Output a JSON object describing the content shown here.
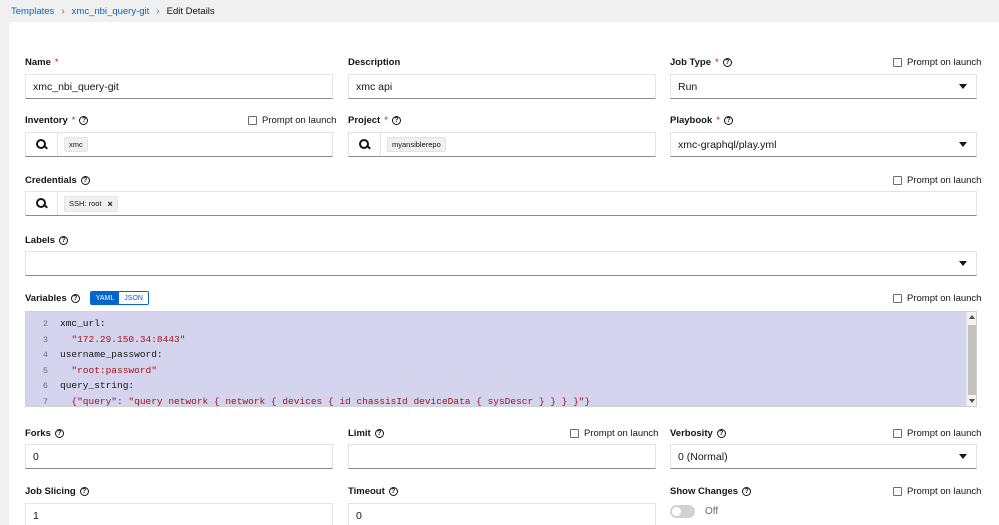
{
  "breadcrumb": {
    "templates": "Templates",
    "template_name": "xmc_nbi_query-git",
    "current": "Edit Details"
  },
  "fields": {
    "name": {
      "label": "Name",
      "value": "xmc_nbi_query-git"
    },
    "description": {
      "label": "Description",
      "value": "xmc api"
    },
    "job_type": {
      "label": "Job Type",
      "value": "Run"
    },
    "inventory": {
      "label": "Inventory",
      "value": "xmc"
    },
    "project": {
      "label": "Project",
      "value": "myansiblerepo"
    },
    "playbook": {
      "label": "Playbook",
      "value": "xmc-graphql/play.yml"
    },
    "credentials": {
      "label": "Credentials",
      "chip": "SSH: root"
    },
    "labels": {
      "label": "Labels",
      "value": ""
    },
    "variables": {
      "label": "Variables",
      "yaml": "YAML",
      "json": "JSON",
      "lines": [
        {
          "n": "2",
          "text": "xmc_url:"
        },
        {
          "n": "3",
          "text": "  \"172.29.150.34:8443\""
        },
        {
          "n": "4",
          "text": "username_password:"
        },
        {
          "n": "5",
          "text": "  \"root:password\""
        },
        {
          "n": "6",
          "text": "query_string:"
        },
        {
          "n": "7",
          "text": "  {\"query\": \"query network { network { devices { id chassisId deviceData { sysDescr } } } }\"}"
        }
      ]
    },
    "forks": {
      "label": "Forks",
      "value": "0"
    },
    "limit": {
      "label": "Limit",
      "value": ""
    },
    "verbosity": {
      "label": "Verbosity",
      "value": "0 (Normal)"
    },
    "job_slicing": {
      "label": "Job Slicing",
      "value": "1"
    },
    "timeout": {
      "label": "Timeout",
      "value": "0"
    },
    "show_changes": {
      "label": "Show Changes",
      "state": "Off"
    }
  },
  "prompt_on_launch": "Prompt on launch",
  "required_marker": "*"
}
